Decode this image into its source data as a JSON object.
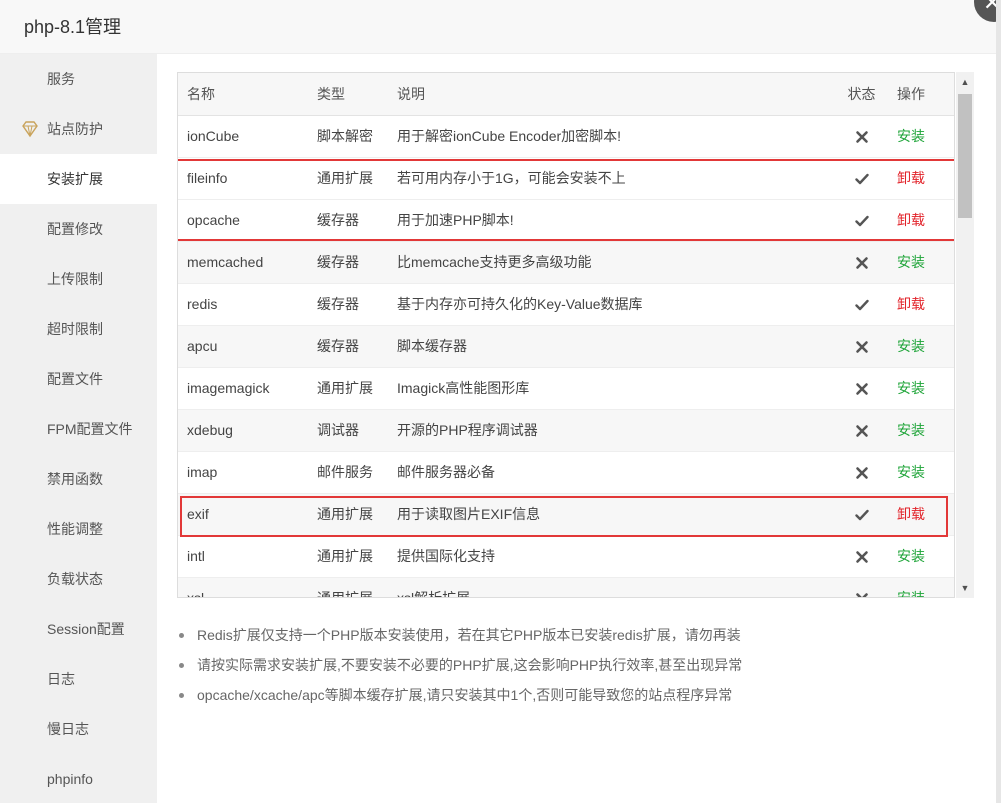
{
  "dialog": {
    "title": "php-8.1管理",
    "close_icon": "close-icon"
  },
  "sidebar": {
    "items": [
      {
        "label": "服务"
      },
      {
        "label": "站点防护",
        "icon": "diamond-icon"
      },
      {
        "label": "安装扩展",
        "active": true
      },
      {
        "label": "配置修改"
      },
      {
        "label": "上传限制"
      },
      {
        "label": "超时限制"
      },
      {
        "label": "配置文件"
      },
      {
        "label": "FPM配置文件"
      },
      {
        "label": "禁用函数"
      },
      {
        "label": "性能调整"
      },
      {
        "label": "负载状态"
      },
      {
        "label": "Session配置"
      },
      {
        "label": "日志"
      },
      {
        "label": "慢日志"
      },
      {
        "label": "phpinfo"
      }
    ]
  },
  "table": {
    "headers": {
      "name": "名称",
      "type": "类型",
      "desc": "说明",
      "status": "状态",
      "action": "操作"
    },
    "rows": [
      {
        "name": "ionCube",
        "type": "脚本解密",
        "desc": "用于解密ionCube Encoder加密脚本!",
        "installed": false,
        "action": "安装"
      },
      {
        "name": "fileinfo",
        "type": "通用扩展",
        "desc": "若可用内存小于1G，可能会安装不上",
        "installed": true,
        "action": "卸载"
      },
      {
        "name": "opcache",
        "type": "缓存器",
        "desc": "用于加速PHP脚本!",
        "installed": true,
        "action": "卸载"
      },
      {
        "name": "memcached",
        "type": "缓存器",
        "desc": "比memcache支持更多高级功能",
        "installed": false,
        "action": "安装"
      },
      {
        "name": "redis",
        "type": "缓存器",
        "desc": "基于内存亦可持久化的Key-Value数据库",
        "installed": true,
        "action": "卸载"
      },
      {
        "name": "apcu",
        "type": "缓存器",
        "desc": "脚本缓存器",
        "installed": false,
        "action": "安装"
      },
      {
        "name": "imagemagick",
        "type": "通用扩展",
        "desc": "Imagick高性能图形库",
        "installed": false,
        "action": "安装"
      },
      {
        "name": "xdebug",
        "type": "调试器",
        "desc": "开源的PHP程序调试器",
        "installed": false,
        "action": "安装"
      },
      {
        "name": "imap",
        "type": "邮件服务",
        "desc": "邮件服务器必备",
        "installed": false,
        "action": "安装"
      },
      {
        "name": "exif",
        "type": "通用扩展",
        "desc": "用于读取图片EXIF信息",
        "installed": true,
        "action": "卸载"
      },
      {
        "name": "intl",
        "type": "通用扩展",
        "desc": "提供国际化支持",
        "installed": false,
        "action": "安装"
      },
      {
        "name": "xsl",
        "type": "通用扩展",
        "desc": "xsl解析扩展",
        "installed": false,
        "action": "安装"
      }
    ]
  },
  "notes": [
    "Redis扩展仅支持一个PHP版本安装使用，若在其它PHP版本已安装redis扩展，请勿再装",
    "请按实际需求安装扩展,不要安装不必要的PHP扩展,这会影响PHP执行效率,甚至出现异常",
    "opcache/xcache/apc等脚本缓存扩展,请只安装其中1个,否则可能导致您的站点程序异常"
  ],
  "colors": {
    "install": "#20a53a",
    "uninstall": "#e2232a",
    "highlight": "#e23838"
  }
}
